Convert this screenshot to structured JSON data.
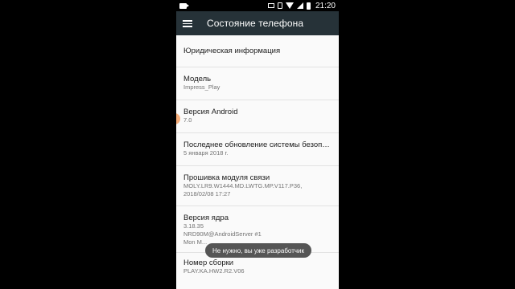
{
  "status_bar": {
    "time": "21:20",
    "icons": [
      "video-recording-icon",
      "cast-icon",
      "nfc-icon",
      "wifi-icon",
      "signal-icon",
      "battery-icon"
    ]
  },
  "app_bar": {
    "title": "Состояние телефона",
    "menu_icon": "hamburger-menu-icon",
    "background": "#263238"
  },
  "items": [
    {
      "title": "Юридическая информация",
      "subtitle": ""
    },
    {
      "title": "Модель",
      "subtitle": "Impress_Play"
    },
    {
      "title": "Версия Android",
      "subtitle": "7.0"
    },
    {
      "title": "Последнее обновление системы безопасн..",
      "subtitle": "5 января 2018 г."
    },
    {
      "title": "Прошивка модуля связи",
      "subtitle": "MOLY.LR9.W1444.MD.LWTG.MP.V117.P36,\n2018/02/08 17:27"
    },
    {
      "title": "Версия ядра",
      "subtitle": "3.18.35\nNRD90M@AndroidServer #1\nMon M..."
    },
    {
      "title": "Номер сборки",
      "subtitle": "PLAY.KA.HW2.R2.V06"
    }
  ],
  "toast": {
    "text": "Не нужно, вы уже разработчик"
  }
}
